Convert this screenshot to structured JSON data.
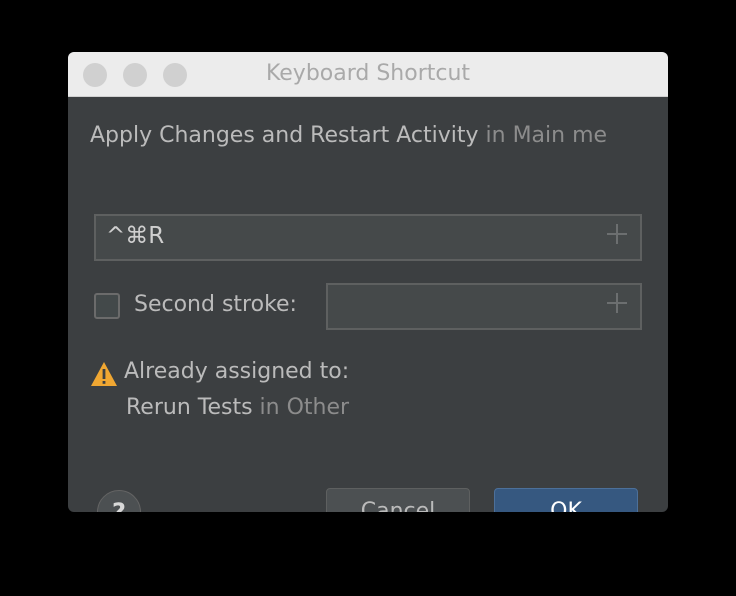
{
  "window": {
    "title": "Keyboard Shortcut"
  },
  "action": {
    "name": "Apply Changes and Restart Activity",
    "location": "in Main me"
  },
  "first_stroke": {
    "value": "^⌘R",
    "add_icon": "plus-icon"
  },
  "second_stroke": {
    "label": "Second stroke:",
    "checked": false,
    "value": "",
    "add_icon": "plus-icon"
  },
  "warning": {
    "icon": "warning-icon",
    "color": "#f0a732",
    "text": "Already assigned to:",
    "conflict_action": "Rerun Tests",
    "conflict_location": "in Other"
  },
  "buttons": {
    "help": "?",
    "cancel": "Cancel",
    "ok": "OK",
    "ok_color": "#365880"
  }
}
